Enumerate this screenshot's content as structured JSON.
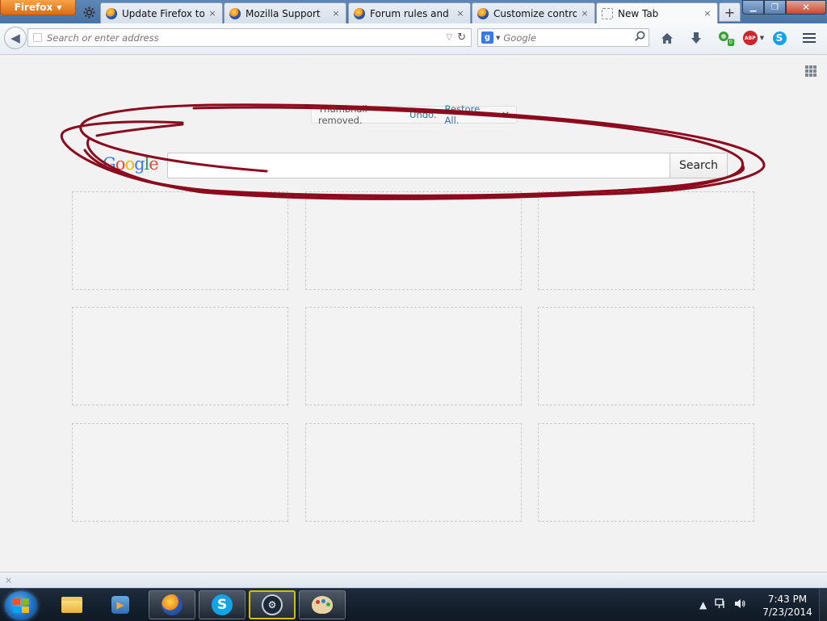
{
  "browser": {
    "menu_button_label": "Firefox",
    "tabs": [
      {
        "title": "Update Firefox to t...",
        "close": "×"
      },
      {
        "title": "Mozilla Support",
        "close": "×"
      },
      {
        "title": "Forum rules and g...",
        "close": "×"
      },
      {
        "title": "Customize control...",
        "close": "×"
      },
      {
        "title": "New Tab",
        "close": "×",
        "active": true
      }
    ],
    "new_tab_symbol": "+",
    "window_controls": {
      "minimize": "▁",
      "maximize": "❐",
      "close": "✕"
    }
  },
  "navbar": {
    "url_placeholder": "Search or enter address",
    "url_value": "",
    "search_engine_letter": "g",
    "search_placeholder": "Google",
    "addon_badge": "0",
    "abp_label": "ABP",
    "skype_letter": "S"
  },
  "newtab": {
    "undo_message": "Thumbnail removed.",
    "undo_link": "Undo.",
    "restore_link": "Restore All.",
    "undo_close": "×",
    "google_logo": [
      "G",
      "o",
      "o",
      "g",
      "l",
      "e"
    ],
    "search_button": "Search",
    "tile_count": 9
  },
  "addon_bar": {
    "close": "×"
  },
  "taskbar": {
    "time": "7:43 PM",
    "date": "7/23/2014",
    "steam_letter": "⚙",
    "skype_letter": "S"
  },
  "icons": {
    "gear": "gear-icon",
    "back": "back-arrow-icon",
    "home": "home-icon",
    "download": "download-arrow-icon",
    "menu": "hamburger-menu-icon",
    "grid": "grid-toggle-icon"
  },
  "colors": {
    "annotation_stroke": "#8b0a1e",
    "link": "#2d6fb5",
    "firefox_button": "#e06b0f"
  }
}
